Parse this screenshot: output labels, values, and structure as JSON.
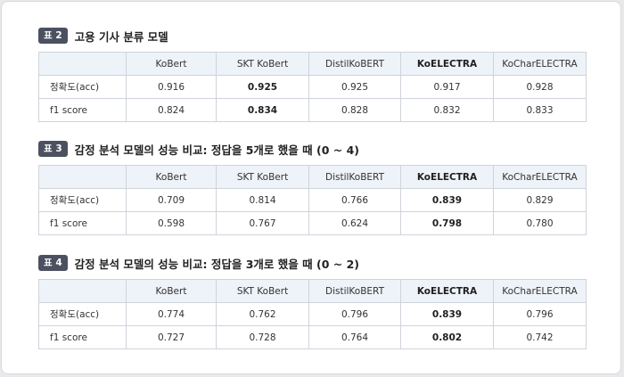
{
  "tables": [
    {
      "badge": "표 2",
      "title": "고용 기사 분류 모델",
      "columns": [
        "",
        "KoBert",
        "SKT KoBert",
        "DistilKoBERT",
        "KoELECTRA",
        "KoCharELECTRA"
      ],
      "rows": [
        {
          "label": "정확도(acc)",
          "values": [
            "0.916",
            "0.925",
            "0.925",
            "0.917",
            "0.928"
          ]
        },
        {
          "label": "f1 score",
          "values": [
            "0.824",
            "0.834",
            "0.828",
            "0.832",
            "0.833"
          ]
        }
      ],
      "bold_header_col": 4,
      "bold_value_col": 1
    },
    {
      "badge": "표 3",
      "title": "감정 분석 모델의 성능 비교: 정답을 5개로 했을 때 (0 ~ 4)",
      "columns": [
        "",
        "KoBert",
        "SKT KoBert",
        "DistilKoBERT",
        "KoELECTRA",
        "KoCharELECTRA"
      ],
      "rows": [
        {
          "label": "정확도(acc)",
          "values": [
            "0.709",
            "0.814",
            "0.766",
            "0.839",
            "0.829"
          ]
        },
        {
          "label": "f1 score",
          "values": [
            "0.598",
            "0.767",
            "0.624",
            "0.798",
            "0.780"
          ]
        }
      ],
      "bold_header_col": 4,
      "bold_value_col": 3
    },
    {
      "badge": "표 4",
      "title": "감정 분석 모델의 성능 비교: 정답을 3개로 했을 때 (0 ~ 2)",
      "columns": [
        "",
        "KoBert",
        "SKT KoBert",
        "DistilKoBERT",
        "KoELECTRA",
        "KoCharELECTRA"
      ],
      "rows": [
        {
          "label": "정확도(acc)",
          "values": [
            "0.774",
            "0.762",
            "0.796",
            "0.839",
            "0.796"
          ]
        },
        {
          "label": "f1 score",
          "values": [
            "0.727",
            "0.728",
            "0.764",
            "0.802",
            "0.742"
          ]
        }
      ],
      "bold_header_col": 4,
      "bold_value_col": 3
    }
  ]
}
